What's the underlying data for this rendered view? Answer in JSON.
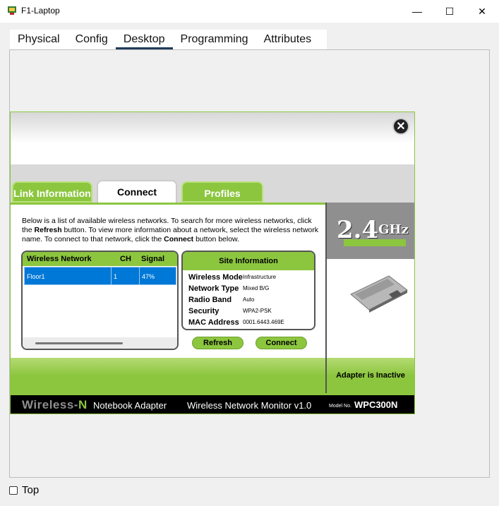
{
  "window": {
    "title": "F1-Laptop",
    "minimize_glyph": "—",
    "maximize_glyph": "☐",
    "close_glyph": "✕"
  },
  "tabs": [
    "Physical",
    "Config",
    "Desktop",
    "Programming",
    "Attributes"
  ],
  "active_tab": "Desktop",
  "adapter": {
    "close_glyph": "✕",
    "tabs": {
      "link_information": "Link Information",
      "connect": "Connect",
      "profiles": "Profiles"
    },
    "description": {
      "p1": "Below is a list of available wireless networks. To search for more wireless networks, click the ",
      "b1": "Refresh",
      "p2": " button. To view more information about a network, select the wireless network name. To connect to that network, click the ",
      "b2": "Connect",
      "p3": " button below."
    },
    "network_list": {
      "headers": {
        "name": "Wireless Network Name",
        "ch": "CH",
        "signal": "Signal"
      },
      "rows": [
        {
          "name": "Floor1",
          "ch": "1",
          "signal": "47%"
        }
      ]
    },
    "site_info": {
      "title": "Site Information",
      "rows": [
        {
          "label": "Wireless Mode",
          "value": "Infrastructure"
        },
        {
          "label": "Network Type",
          "value": "Mixed B/G"
        },
        {
          "label": "Radio Band",
          "value": "Auto"
        },
        {
          "label": "Security",
          "value": "WPA2-PSK"
        },
        {
          "label": "MAC Address",
          "value": "0001.6443.469E"
        }
      ]
    },
    "buttons": {
      "refresh": "Refresh",
      "connect": "Connect"
    },
    "band": {
      "value": "2.4",
      "unit": "GHz"
    },
    "status": "Adapter is Inactive",
    "footer": {
      "brand_a": "Wireless-",
      "brand_b": "N",
      "product": "Notebook Adapter",
      "monitor": "Wireless Network Monitor  v1.0",
      "model_label": "Model No.",
      "model": "WPC300N"
    }
  },
  "top_checkbox": {
    "label": "Top",
    "checked": false
  },
  "colors": {
    "accent_green": "#8cc63f",
    "selection_blue": "#0078d7"
  }
}
